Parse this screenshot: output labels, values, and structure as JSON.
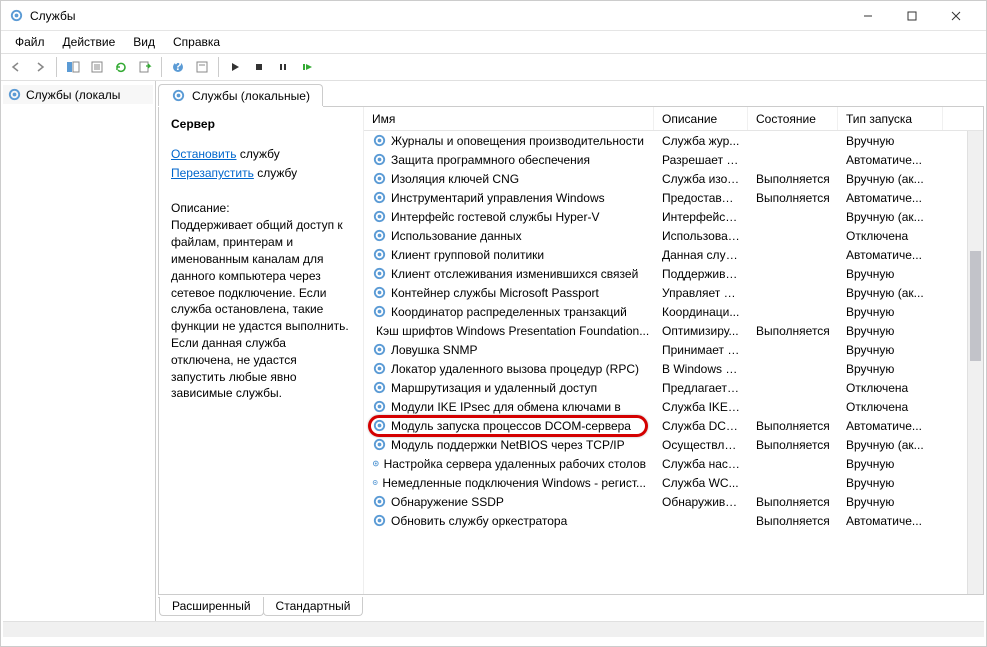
{
  "window": {
    "title": "Службы"
  },
  "menubar": [
    "Файл",
    "Действие",
    "Вид",
    "Справка"
  ],
  "tree": {
    "item": "Службы (локалы"
  },
  "tab": {
    "label": "Службы (локальные)"
  },
  "detail": {
    "title": "Сервер",
    "stop_label": "Остановить",
    "restart_label": "Перезапустить",
    "service_word": "службу",
    "desc_label": "Описание:",
    "desc_text": "Поддерживает общий доступ к файлам, принтерам и именованным каналам для данного компьютера через сетевое подключение. Если служба остановлена, такие функции не удастся выполнить. Если данная служба отключена, не удастся запустить любые явно зависимые службы."
  },
  "columns": {
    "name": "Имя",
    "desc": "Описание",
    "state": "Состояние",
    "start": "Тип запуска"
  },
  "services": [
    {
      "name": "Журналы и оповещения производительности",
      "desc": "Служба жур...",
      "state": "",
      "start": "Вручную"
    },
    {
      "name": "Защита программного обеспечения",
      "desc": "Разрешает с...",
      "state": "",
      "start": "Автоматиче..."
    },
    {
      "name": "Изоляция ключей CNG",
      "desc": "Служба изол...",
      "state": "Выполняется",
      "start": "Вручную (ак..."
    },
    {
      "name": "Инструментарий управления Windows",
      "desc": "Предоставля...",
      "state": "Выполняется",
      "start": "Автоматиче..."
    },
    {
      "name": "Интерфейс гостевой службы Hyper-V",
      "desc": "Интерфейс д...",
      "state": "",
      "start": "Вручную (ак..."
    },
    {
      "name": "Использование данных",
      "desc": "Использован...",
      "state": "",
      "start": "Отключена"
    },
    {
      "name": "Клиент групповой политики",
      "desc": "Данная служ...",
      "state": "",
      "start": "Автоматиче..."
    },
    {
      "name": "Клиент отслеживания изменившихся связей",
      "desc": "Поддержива...",
      "state": "",
      "start": "Вручную"
    },
    {
      "name": "Контейнер службы Microsoft Passport",
      "desc": "Управляет кл...",
      "state": "",
      "start": "Вручную (ак..."
    },
    {
      "name": "Координатор распределенных транзакций",
      "desc": "Координаци...",
      "state": "",
      "start": "Вручную"
    },
    {
      "name": "Кэш шрифтов Windows Presentation Foundation...",
      "desc": "Оптимизиру...",
      "state": "Выполняется",
      "start": "Вручную"
    },
    {
      "name": "Ловушка SNMP",
      "desc": "Принимает с...",
      "state": "",
      "start": "Вручную"
    },
    {
      "name": "Локатор удаленного вызова процедур (RPC)",
      "desc": "В Windows 2...",
      "state": "",
      "start": "Вручную"
    },
    {
      "name": "Маршрутизация и удаленный доступ",
      "desc": "Предлагает у...",
      "state": "",
      "start": "Отключена"
    },
    {
      "name": "Модули IKE IPsec для обмена ключами в",
      "desc": "Служба IKEE...",
      "state": "",
      "start": "Отключена"
    },
    {
      "name": "Модуль запуска процессов DCOM-сервера",
      "desc": "Служба DCO...",
      "state": "Выполняется",
      "start": "Автоматиче...",
      "highlight": true
    },
    {
      "name": "Модуль поддержки NetBIOS через TCP/IP",
      "desc": "Осуществля...",
      "state": "Выполняется",
      "start": "Вручную (ак..."
    },
    {
      "name": "Настройка сервера удаленных рабочих столов",
      "desc": "Служба наст...",
      "state": "",
      "start": "Вручную"
    },
    {
      "name": "Немедленные подключения Windows - регист...",
      "desc": "Служба WC...",
      "state": "",
      "start": "Вручную"
    },
    {
      "name": "Обнаружение SSDP",
      "desc": "Обнаружива...",
      "state": "Выполняется",
      "start": "Вручную"
    },
    {
      "name": "Обновить службу оркестратора",
      "desc": "",
      "state": "Выполняется",
      "start": "Автоматиче..."
    }
  ],
  "bottom_tabs": {
    "extended": "Расширенный",
    "standard": "Стандартный"
  }
}
